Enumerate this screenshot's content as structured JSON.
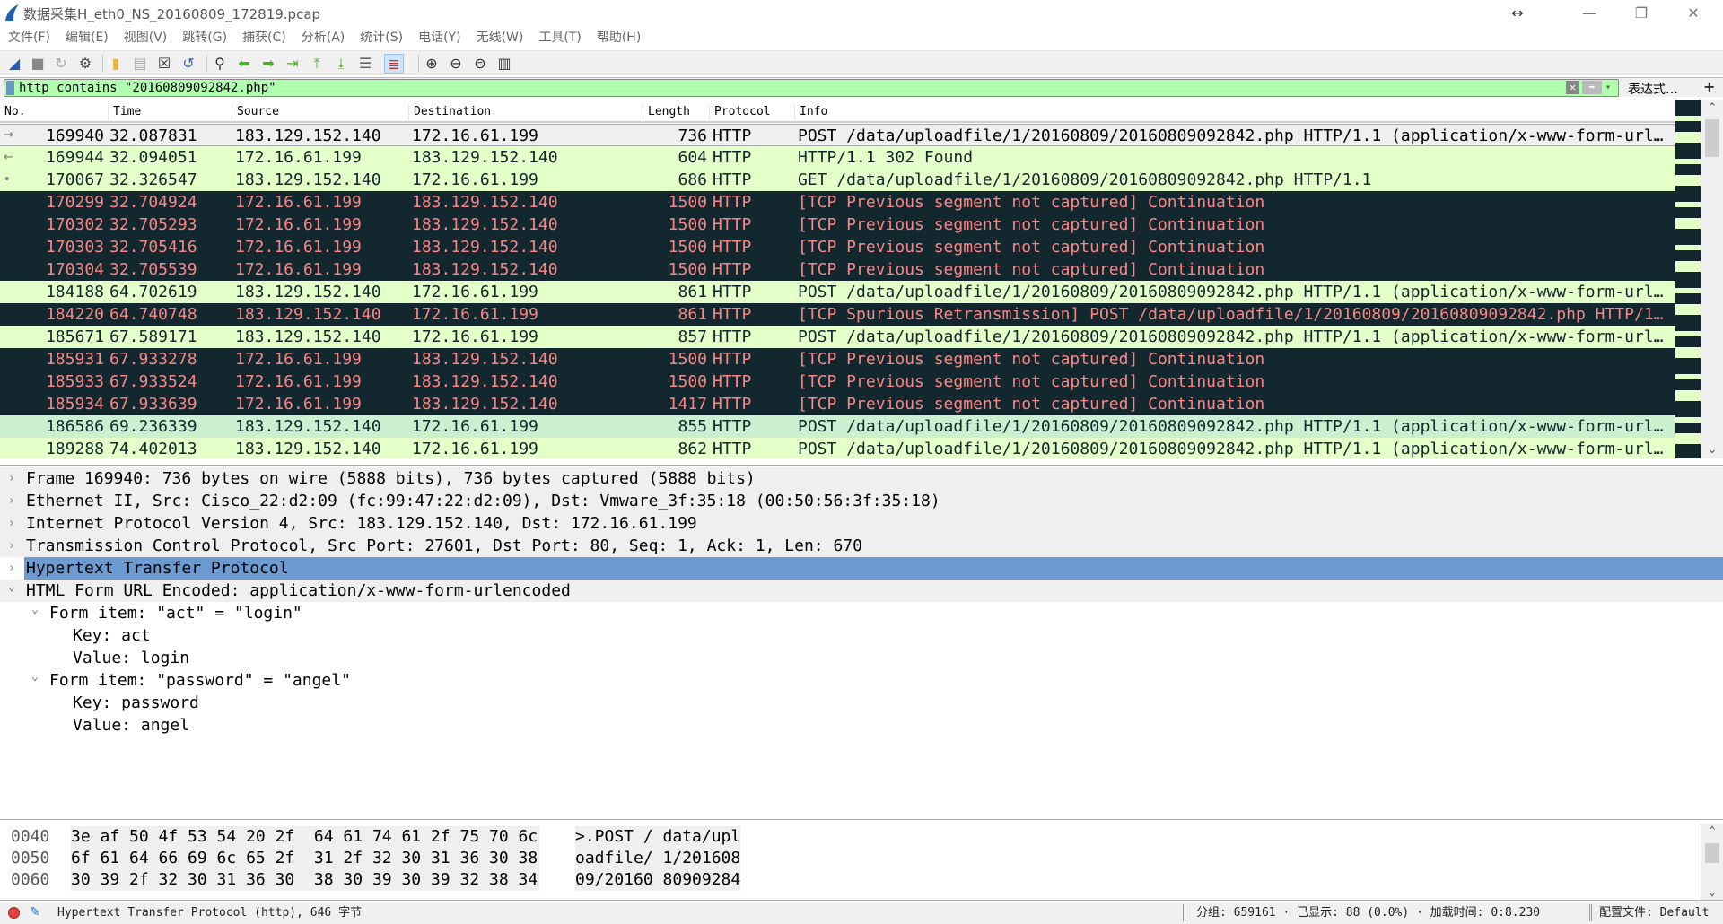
{
  "window": {
    "title": "数据采集H_eth0_NS_20160809_172819.pcap",
    "resize_glyph": "↔",
    "minimize": "—",
    "maximize": "❐",
    "close": "✕"
  },
  "menu": [
    "文件(F)",
    "编辑(E)",
    "视图(V)",
    "跳转(G)",
    "捕获(C)",
    "分析(A)",
    "统计(S)",
    "电话(Y)",
    "无线(W)",
    "工具(T)",
    "帮助(H)"
  ],
  "toolbar": [
    "start-capture",
    "stop-capture",
    "restart-capture",
    "capture-options",
    "open-file",
    "file-set",
    "close-file",
    "reload-file",
    "find-packet",
    "go-back",
    "go-forward",
    "go-to-packet",
    "first-packet",
    "last-packet",
    "auto-scroll",
    "colorize",
    "zoom-in",
    "zoom-out",
    "normal-size",
    "resize-columns"
  ],
  "filter": {
    "value": "http contains \"20160809092842.php\"",
    "expression_label": "表达式…",
    "add_label": "+"
  },
  "packet_list": {
    "columns": [
      "No.",
      "Time",
      "Source",
      "Destination",
      "Length",
      "Protocol",
      "Info"
    ],
    "rows": [
      {
        "style": "sel",
        "no": "169940",
        "time": "32.087831",
        "src": "183.129.152.140",
        "dst": "172.16.61.199",
        "len": "736",
        "proto": "HTTP",
        "info": "POST /data/uploadfile/1/20160809/20160809092842.php HTTP/1.1  (application/x-www-form-urlencoded)"
      },
      {
        "style": "green",
        "no": "169944",
        "time": "32.094051",
        "src": "172.16.61.199",
        "dst": "183.129.152.140",
        "len": "604",
        "proto": "HTTP",
        "info": "HTTP/1.1 302 Found"
      },
      {
        "style": "green",
        "no": "170067",
        "time": "32.326547",
        "src": "183.129.152.140",
        "dst": "172.16.61.199",
        "len": "686",
        "proto": "HTTP",
        "info": "GET /data/uploadfile/1/20160809/20160809092842.php HTTP/1.1"
      },
      {
        "style": "dark",
        "no": "170299",
        "time": "32.704924",
        "src": "172.16.61.199",
        "dst": "183.129.152.140",
        "len": "1500",
        "proto": "HTTP",
        "info": "[TCP Previous segment not captured] Continuation"
      },
      {
        "style": "dark",
        "no": "170302",
        "time": "32.705293",
        "src": "172.16.61.199",
        "dst": "183.129.152.140",
        "len": "1500",
        "proto": "HTTP",
        "info": "[TCP Previous segment not captured] Continuation"
      },
      {
        "style": "dark",
        "no": "170303",
        "time": "32.705416",
        "src": "172.16.61.199",
        "dst": "183.129.152.140",
        "len": "1500",
        "proto": "HTTP",
        "info": "[TCP Previous segment not captured] Continuation"
      },
      {
        "style": "dark",
        "no": "170304",
        "time": "32.705539",
        "src": "172.16.61.199",
        "dst": "183.129.152.140",
        "len": "1500",
        "proto": "HTTP",
        "info": "[TCP Previous segment not captured] Continuation"
      },
      {
        "style": "green",
        "no": "184188",
        "time": "64.702619",
        "src": "183.129.152.140",
        "dst": "172.16.61.199",
        "len": "861",
        "proto": "HTTP",
        "info": "POST /data/uploadfile/1/20160809/20160809092842.php HTTP/1.1  (application/x-www-form-urlencoded)"
      },
      {
        "style": "dark",
        "no": "184220",
        "time": "64.740748",
        "src": "183.129.152.140",
        "dst": "172.16.61.199",
        "len": "861",
        "proto": "HTTP",
        "info": "[TCP Spurious Retransmission] POST /data/uploadfile/1/20160809/20160809092842.php HTTP/1.1"
      },
      {
        "style": "green",
        "no": "185671",
        "time": "67.589171",
        "src": "183.129.152.140",
        "dst": "172.16.61.199",
        "len": "857",
        "proto": "HTTP",
        "info": "POST /data/uploadfile/1/20160809/20160809092842.php HTTP/1.1  (application/x-www-form-urlencoded)"
      },
      {
        "style": "dark",
        "no": "185931",
        "time": "67.933278",
        "src": "172.16.61.199",
        "dst": "183.129.152.140",
        "len": "1500",
        "proto": "HTTP",
        "info": "[TCP Previous segment not captured] Continuation"
      },
      {
        "style": "dark",
        "no": "185933",
        "time": "67.933524",
        "src": "172.16.61.199",
        "dst": "183.129.152.140",
        "len": "1500",
        "proto": "HTTP",
        "info": "[TCP Previous segment not captured] Continuation"
      },
      {
        "style": "dark",
        "no": "185934",
        "time": "67.933639",
        "src": "172.16.61.199",
        "dst": "183.129.152.140",
        "len": "1417",
        "proto": "HTTP",
        "info": "[TCP Previous segment not captured] Continuation"
      },
      {
        "style": "green2",
        "no": "186586",
        "time": "69.236339",
        "src": "183.129.152.140",
        "dst": "172.16.61.199",
        "len": "855",
        "proto": "HTTP",
        "info": "POST /data/uploadfile/1/20160809/20160809092842.php HTTP/1.1  (application/x-www-form-urlencoded)"
      },
      {
        "style": "green",
        "no": "189288",
        "time": "74.402013",
        "src": "183.129.152.140",
        "dst": "172.16.61.199",
        "len": "862",
        "proto": "HTTP",
        "info": "POST /data/uploadfile/1/20160809/20160809092842.php HTTP/1.1  (application/x-www-form-urlencoded)"
      }
    ]
  },
  "details": [
    {
      "level": 0,
      "expanded": false,
      "style": "top",
      "text": "Frame 169940: 736 bytes on wire (5888 bits), 736 bytes captured (5888 bits)"
    },
    {
      "level": 0,
      "expanded": false,
      "style": "top",
      "text": "Ethernet II, Src: Cisco_22:d2:09 (fc:99:47:22:d2:09), Dst: Vmware_3f:35:18 (00:50:56:3f:35:18)"
    },
    {
      "level": 0,
      "expanded": false,
      "style": "top",
      "text": "Internet Protocol Version 4, Src: 183.129.152.140, Dst: 172.16.61.199"
    },
    {
      "level": 0,
      "expanded": false,
      "style": "top",
      "text": "Transmission Control Protocol, Src Port: 27601, Dst Port: 80, Seq: 1, Ack: 1, Len: 670"
    },
    {
      "level": 0,
      "expanded": false,
      "style": "hl",
      "text": "Hypertext Transfer Protocol"
    },
    {
      "level": 0,
      "expanded": true,
      "style": "top",
      "text": "HTML Form URL Encoded: application/x-www-form-urlencoded"
    },
    {
      "level": 1,
      "expanded": true,
      "style": "",
      "text": "Form item: \"act\" = \"login\""
    },
    {
      "level": 2,
      "expanded": null,
      "style": "",
      "text": "Key: act"
    },
    {
      "level": 2,
      "expanded": null,
      "style": "",
      "text": "Value: login"
    },
    {
      "level": 1,
      "expanded": true,
      "style": "",
      "text": "Form item: \"password\" = \"angel\""
    },
    {
      "level": 2,
      "expanded": null,
      "style": "",
      "text": "Key: password"
    },
    {
      "level": 2,
      "expanded": null,
      "style": "",
      "text": "Value: angel"
    }
  ],
  "bytes": [
    {
      "offset": "0040",
      "hex": "3e af 50 4f 53 54 20 2f  64 61 74 61 2f 75 70 6c",
      "ascii": ">.POST / data/upl"
    },
    {
      "offset": "0050",
      "hex": "6f 61 64 66 69 6c 65 2f  31 2f 32 30 31 36 30 38",
      "ascii": "oadfile/ 1/201608"
    },
    {
      "offset": "0060",
      "hex": "30 39 2f 32 30 31 36 30  38 30 39 30 39 32 38 34",
      "ascii": "09/20160 80909284"
    }
  ],
  "status": {
    "field": "Hypertext Transfer Protocol (http), 646 字节",
    "packets": "分组: 659161 · 已显示: 88 (0.0%) · 加载时间: 0:8.230",
    "profile": "配置文件: Default"
  },
  "colors": {
    "green": "#e4ffc7",
    "dark": "#12272e",
    "dark_text": "#f78787",
    "filter_ok": "#afffaf",
    "highlight": "#6c9bd2"
  }
}
